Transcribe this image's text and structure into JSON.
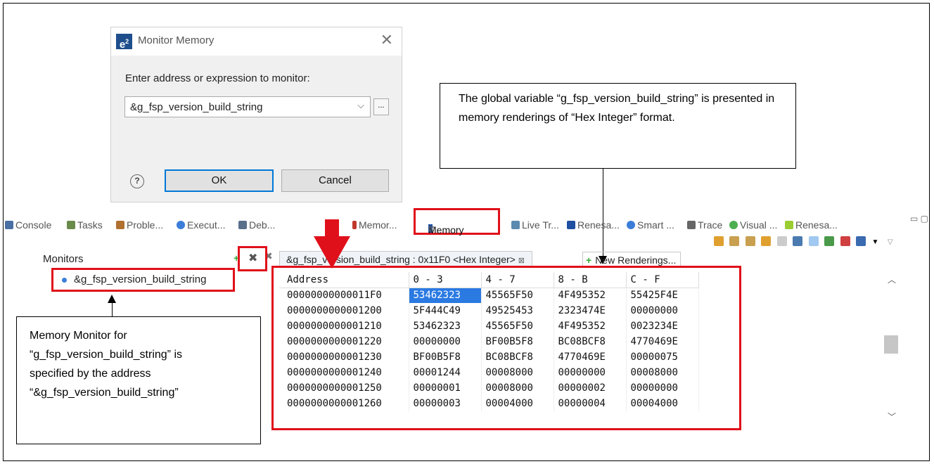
{
  "dialog": {
    "logo": "e",
    "logo_sup": "2",
    "title": "Monitor Memory",
    "close_glyph": "✕",
    "prompt": "Enter address or expression to monitor:",
    "expression_value": "&g_fsp_version_build_string",
    "browse_label": "...",
    "help_glyph": "?",
    "ok_label": "OK",
    "cancel_label": "Cancel"
  },
  "callouts": {
    "global_variable": "The global variable “g_fsp_version_build_string” is presented in memory renderings of “Hex Integer” format.",
    "monitor_line1": "Memory Monitor for",
    "monitor_line2": "“g_fsp_version_build_string” is",
    "monitor_line3": "specified by the address",
    "monitor_line4": "“&g_fsp_version_build_string”"
  },
  "view_tabs": [
    {
      "label": "Console",
      "icon": "console-icon",
      "color": "#4a6fa5"
    },
    {
      "label": "Tasks",
      "icon": "tasks-icon",
      "color": "#6a8a4a"
    },
    {
      "label": "Proble...",
      "icon": "problems-icon",
      "color": "#b07030"
    },
    {
      "label": "Execut...",
      "icon": "executable-icon",
      "color": "#3b7dd8"
    },
    {
      "label": "Deb...",
      "icon": "debugger-icon",
      "color": "#5a6f8a"
    },
    {
      "label": "Memor...",
      "icon": "memory-icon",
      "color": "#c0392b"
    },
    {
      "label": "Live Tr...",
      "icon": "live-trace-icon",
      "color": "#5a8ab0"
    },
    {
      "label": "Renesa...",
      "icon": "renesas-icon",
      "color": "#1f4fa0"
    },
    {
      "label": "Smart ...",
      "icon": "smart-icon",
      "color": "#3b7dd8"
    },
    {
      "label": "Trace",
      "icon": "trace-icon",
      "color": "#666666"
    },
    {
      "label": "Visual ...",
      "icon": "visual-icon",
      "color": "#4caf50"
    },
    {
      "label": "Renesa...",
      "icon": "renesas-icon",
      "color": "#9acd32"
    }
  ],
  "active_tab": {
    "label": "Memory",
    "close": "⊠"
  },
  "monitors": {
    "title": "Monitors",
    "add_glyph": "+",
    "remove_glyph": "✖",
    "remove_all_glyph": "✖",
    "items": [
      "&g_fsp_version_build_string"
    ]
  },
  "rendering": {
    "tab_label": "&g_fsp_version_build_string : 0x11F0 <Hex Integer>",
    "tab_close": "⊠",
    "new_label": "New Renderings..."
  },
  "memory_table": {
    "headers": [
      "Address",
      "0 - 3",
      "4 - 7",
      "8 - B",
      "C - F"
    ],
    "rows": [
      [
        "00000000000011F0",
        "53462323",
        "45565F50",
        "4F495352",
        "55425F4E"
      ],
      [
        "0000000000001200",
        "5F444C49",
        "49525453",
        "2323474E",
        "00000000"
      ],
      [
        "0000000000001210",
        "53462323",
        "45565F50",
        "4F495352",
        "0023234E"
      ],
      [
        "0000000000001220",
        "00000000",
        "BF00B5F8",
        "BC08BCF8",
        "4770469E"
      ],
      [
        "0000000000001230",
        "BF00B5F8",
        "BC08BCF8",
        "4770469E",
        "00000075"
      ],
      [
        "0000000000001240",
        "00001244",
        "00008000",
        "00000000",
        "00008000"
      ],
      [
        "0000000000001250",
        "00000001",
        "00008000",
        "00000002",
        "00000000"
      ],
      [
        "0000000000001260",
        "00000003",
        "00004000",
        "00000004",
        "00004000"
      ]
    ],
    "selected_cell": "53462323"
  },
  "colors": {
    "highlight": "#e0101a",
    "selection": "#2a7ae2"
  }
}
